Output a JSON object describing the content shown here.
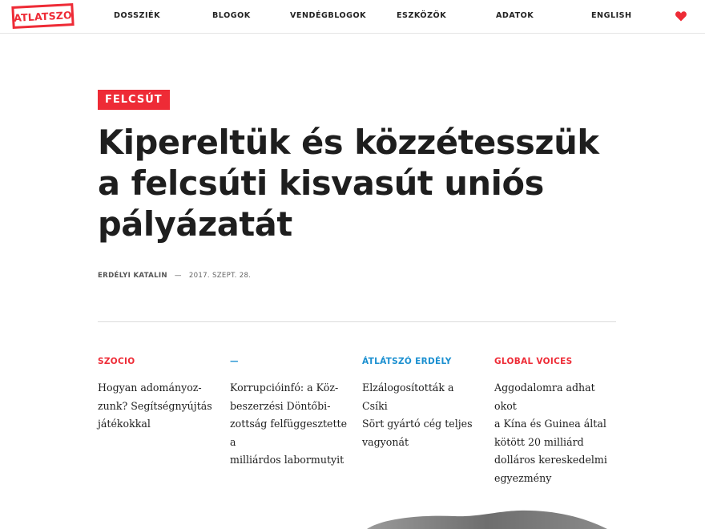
{
  "site": {
    "logo_text": "ATLATSZO",
    "brand_color": "#ee2b36"
  },
  "nav": {
    "items": [
      {
        "label": "DOSSZIÉK"
      },
      {
        "label": "BLOGOK"
      },
      {
        "label": "VENDÉGBLOGOK"
      },
      {
        "label": "ESZKÖZÖK"
      },
      {
        "label": "ADATOK"
      },
      {
        "label": "ENGLISH"
      }
    ],
    "heart_icon": "heart-icon"
  },
  "article": {
    "tag": "FELCSÚT",
    "title_lines": [
      "Kipereltük és közzétesszük",
      "a felcsúti kisvasút uniós",
      "pályázatát"
    ],
    "author": "ERDÉLYI KATALIN",
    "separator": "—",
    "date": "2017. SZEPT. 28."
  },
  "related": [
    {
      "category": "SZOCIO",
      "category_color": "#ee2b36",
      "title_lines": [
        "Hogyan adományoz-",
        "zunk? Segítségnyújtás",
        "játékokkal"
      ]
    },
    {
      "category": "—",
      "category_color": "#1a8fd0",
      "title_lines": [
        "Korrupcióinfó: a Köz-",
        "beszerzési Döntőbi-",
        "zottság felfüggesztette a",
        "milliárdos labormutyit"
      ]
    },
    {
      "category": "ÁTLÁTSZÓ ERDÉLY",
      "category_color": "#1a8fd0",
      "title_lines": [
        "Elzálogosították a Csíki",
        "Sört gyártó cég teljes",
        "vagyonát"
      ]
    },
    {
      "category": "GLOBAL VOICES",
      "category_color": "#ee2b36",
      "title_lines": [
        "Aggodalomra adhat okot",
        "a Kína és Guinea által",
        "kötött 20 milliárd",
        "dolláros kereskedelmi",
        "egyezmény"
      ]
    }
  ]
}
